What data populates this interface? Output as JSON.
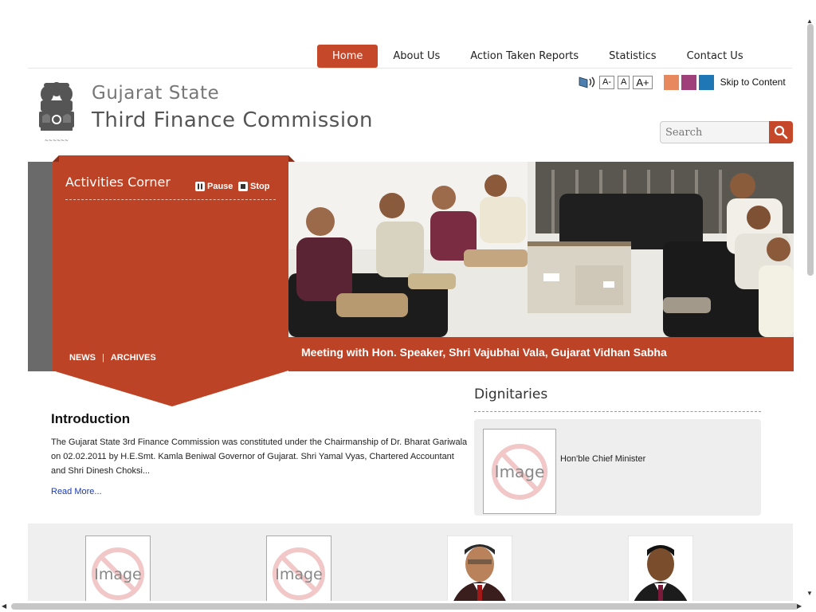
{
  "nav": {
    "items": [
      "Home",
      "About Us",
      "Action Taken Reports",
      "Statistics",
      "Contact Us"
    ],
    "active": "Home"
  },
  "header": {
    "emblem_icon": "state-emblem-icon",
    "title_line1": "Gujarat State",
    "title_line2": "Third Finance Commission"
  },
  "tools": {
    "screen_reader_icon": "speaker-icon",
    "font_small": "A-",
    "font_normal": "A",
    "font_large": "A+",
    "theme_colors": [
      "#e8885f",
      "#a0407a",
      "#1f78b5"
    ],
    "skip_label": "Skip to Content"
  },
  "search": {
    "placeholder": "Search",
    "icon": "search-icon"
  },
  "activities": {
    "title": "Activities Corner",
    "pause_label": "Pause",
    "stop_label": "Stop",
    "news_label": "NEWS",
    "separator": "|",
    "archives_label": "ARCHIVES"
  },
  "banner": {
    "caption": "Meeting with Hon. Speaker, Shri Vajubhai Vala, Gujarat Vidhan Sabha"
  },
  "intro": {
    "heading": "Introduction",
    "body": "The Gujarat State 3rd Finance Commission was constituted under the Chairmanship of Dr. Bharat Gariwala on 02.02.2011 by H.E.Smt. Kamla Beniwal Governor of Gujarat. Shri Yamal Vyas, Chartered Accountant and Shri Dinesh Choksi...",
    "read_more": "Read More..."
  },
  "dignitaries": {
    "heading": "Dignitaries",
    "items": [
      {
        "name": "Hon'ble Chief Minister",
        "image": "no-image-placeholder"
      }
    ]
  },
  "bottom_gallery": [
    {
      "image": "no-image-placeholder"
    },
    {
      "image": "no-image-placeholder"
    },
    {
      "image": "portrait-photo"
    },
    {
      "image": "portrait-photo"
    }
  ],
  "colors": {
    "accent": "#c5482b",
    "banner_caption": "#bd4326",
    "activities_bg": "#bd4326"
  }
}
